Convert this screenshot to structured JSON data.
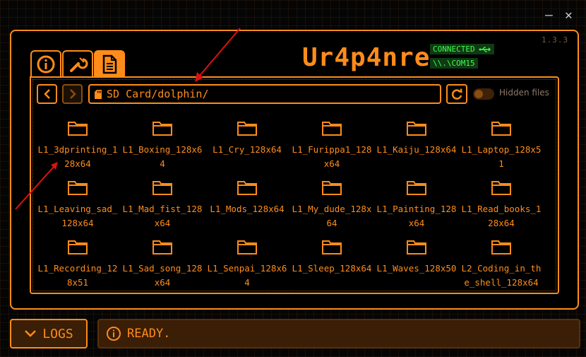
{
  "window": {
    "minimize_glyph": "—",
    "close_glyph": "✕"
  },
  "version": "1.3.3",
  "logo": "Ur4p4nre",
  "connection": {
    "status": "CONNECTED",
    "port": "\\\\.\\COM15",
    "icon": "usb-icon"
  },
  "tabs": [
    {
      "name": "info",
      "icon": "info-icon",
      "active": false
    },
    {
      "name": "tools",
      "icon": "wrench-icon",
      "active": false
    },
    {
      "name": "files",
      "icon": "document-icon",
      "active": true
    }
  ],
  "toolbar": {
    "path": "SD Card/dolphin/",
    "hidden_files_label": "Hidden files",
    "hidden_files_on": false
  },
  "files": [
    "L1_3dprinting_128x64",
    "L1_Boxing_128x64",
    "L1_Cry_128x64",
    "L1_Furippa1_128x64",
    "L1_Kaiju_128x64",
    "L1_Laptop_128x51",
    "L1_Leaving_sad_128x64",
    "L1_Mad_fist_128x64",
    "L1_Mods_128x64",
    "L1_My_dude_128x64",
    "L1_Painting_128x64",
    "L1_Read_books_128x64",
    "L1_Recording_128x51",
    "L1_Sad_song_128x64",
    "L1_Senpai_128x64",
    "L1_Sleep_128x64",
    "L1_Waves_128x50",
    "L2_Coding_in_the_shell_128x64"
  ],
  "footer": {
    "logs_label": "LOGS",
    "status": "READY."
  },
  "colors": {
    "accent": "#ff8c1a",
    "connected": "#3dff4d",
    "annotation": "#e01010"
  }
}
